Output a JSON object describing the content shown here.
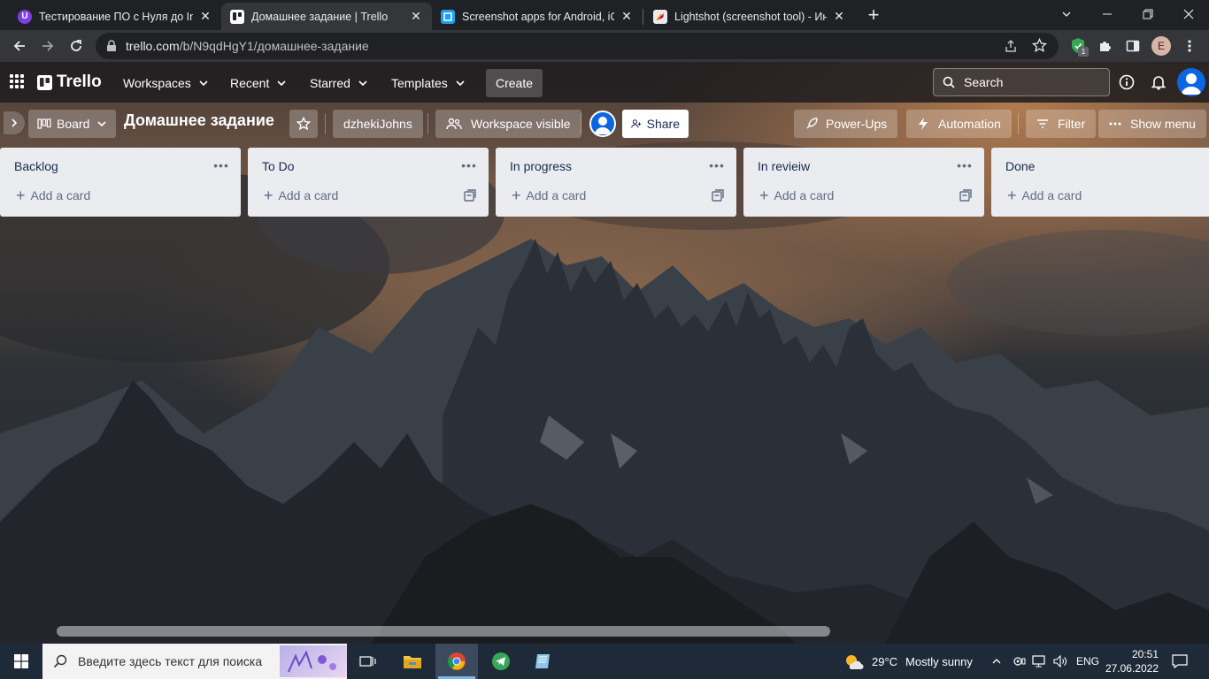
{
  "browser": {
    "tabs": [
      {
        "title": "Тестирование ПО с Нуля до Inte",
        "favicon": "purple-u-icon",
        "active": false
      },
      {
        "title": "Домашнее задание | Trello",
        "favicon": "trello-icon",
        "active": true
      },
      {
        "title": "Screenshot apps for Android, iOS",
        "favicon": "lightshot-blue-icon",
        "active": false
      },
      {
        "title": "Lightshot (screenshot tool) - Инт",
        "favicon": "lightshot-feather-icon",
        "active": false
      }
    ],
    "url_host": "trello.com",
    "url_path": "/b/N9qdHgY1/домашнее-задание",
    "profile_initial": "E",
    "extension_badge": "1"
  },
  "trello": {
    "logo": "Trello",
    "nav": {
      "workspaces": "Workspaces",
      "recent": "Recent",
      "starred": "Starred",
      "templates": "Templates",
      "create": "Create"
    },
    "search_label": "Search",
    "board": {
      "view": "Board",
      "title": "Домашнее задание",
      "workspace": "dzhekiJohns",
      "visibility": "Workspace visible",
      "share": "Share",
      "power_ups": "Power-Ups",
      "automation": "Automation",
      "filter": "Filter",
      "show_menu": "Show menu"
    },
    "lists": [
      {
        "title": "Backlog",
        "add_card": "Add a card"
      },
      {
        "title": "To Do",
        "add_card": "Add a card"
      },
      {
        "title": "In progress",
        "add_card": "Add a card"
      },
      {
        "title": "In revieiw",
        "add_card": "Add a card"
      },
      {
        "title": "Done",
        "add_card": "Add a card"
      }
    ]
  },
  "taskbar": {
    "search_placeholder": "Введите здесь текст для поиска",
    "weather_temp": "29°C",
    "weather_text": "Mostly sunny",
    "language": "ENG",
    "time": "20:51",
    "date": "27.06.2022"
  },
  "colors": {
    "chrome_bg": "#202124",
    "chrome_toolbar": "#35363a",
    "trello_list_bg": "#ebecf0",
    "trello_text": "#172b4d",
    "avatar_blue": "#0c66e4",
    "taskbar": "#1e2a38"
  }
}
